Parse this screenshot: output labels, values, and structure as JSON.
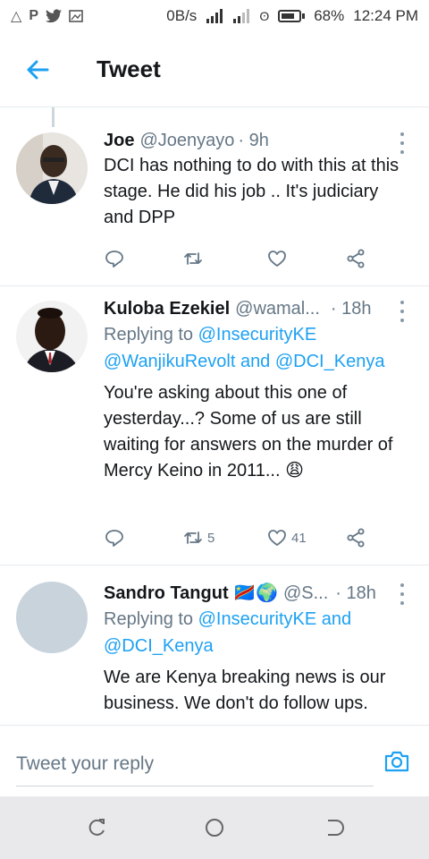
{
  "status_bar": {
    "speed": "0B/s",
    "battery": "68%",
    "time": "12:24 PM"
  },
  "header": {
    "title": "Tweet"
  },
  "tweets": [
    {
      "author": "Joe",
      "handle": "@Joenyayo",
      "time": "· 9h",
      "reply_prefix": "",
      "mentions": "",
      "text": "DCI has nothing to do with this at this stage. He did his job .. It's judiciary and DPP",
      "retweets": "",
      "likes": ""
    },
    {
      "author": "Kuloba Ezekiel",
      "handle": "@wamal...",
      "time": "· 18h",
      "reply_prefix": "Replying to ",
      "mentions": "@InsecurityKE @WanjikuRevolt and @DCI_Kenya",
      "text": "You're asking about this one of yesterday...? Some of us are still waiting for answers on the murder of Mercy Keino in 2011... 😩",
      "retweets": "5",
      "likes": "41"
    },
    {
      "author": "Sandro Tangut 🇨🇩🌍",
      "handle": "@S...",
      "time": "· 18h",
      "reply_prefix": "Replying to ",
      "mentions": "@InsecurityKE and @DCI_Kenya",
      "text": "We are Kenya breaking news is our business. We don't do follow ups.",
      "retweets": "",
      "likes": ""
    }
  ],
  "composer": {
    "placeholder": "Tweet your reply"
  },
  "colors": {
    "accent": "#1da1f2",
    "secondary_text": "#657786"
  }
}
